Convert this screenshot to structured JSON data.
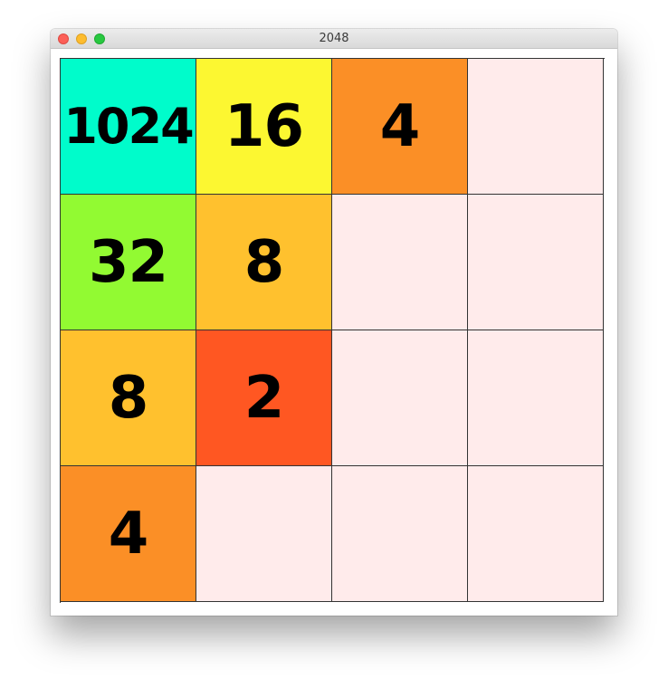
{
  "window": {
    "title": "2048"
  },
  "colors": {
    "empty": "#ffebeb",
    "2": "#ff5722",
    "4": "#fb8f26",
    "8": "#ffc12e",
    "16": "#fcf731",
    "32": "#92fa32",
    "1024": "#00fccb"
  },
  "board": {
    "rows": [
      [
        "1024",
        "16",
        "4",
        ""
      ],
      [
        "32",
        "8",
        "",
        ""
      ],
      [
        "8",
        "2",
        "",
        ""
      ],
      [
        "4",
        "",
        "",
        ""
      ]
    ]
  }
}
